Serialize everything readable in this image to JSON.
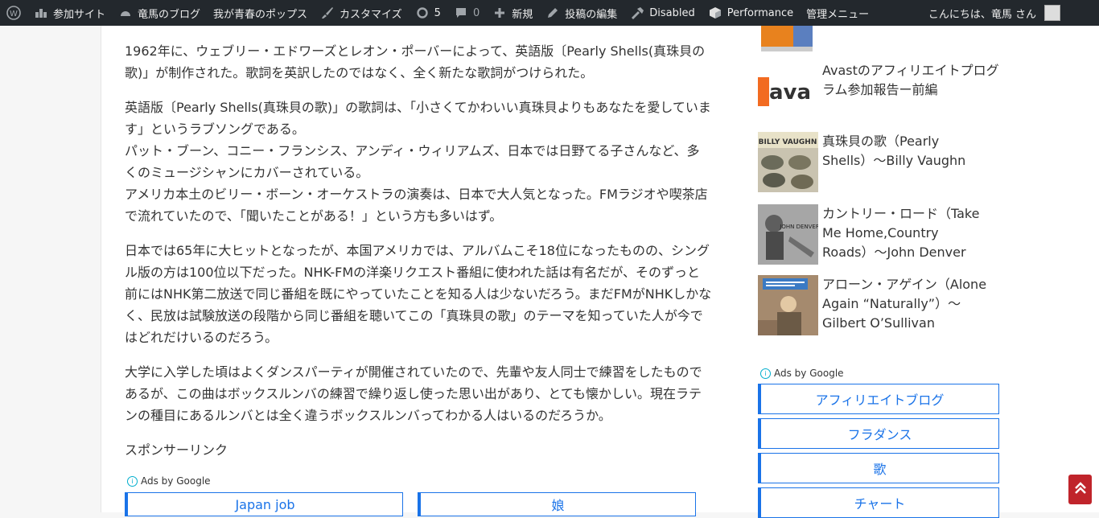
{
  "adminbar": {
    "items": [
      {
        "icon": "wordpress-icon",
        "label": ""
      },
      {
        "icon": "sites-icon",
        "label": "参加サイト"
      },
      {
        "icon": "dashboard-icon",
        "label": "竜馬のブログ"
      },
      {
        "icon": "",
        "label": "我が青春のポップス"
      },
      {
        "icon": "brush-icon",
        "label": "カスタマイズ"
      },
      {
        "icon": "updates-icon",
        "label": "5"
      },
      {
        "icon": "comment-icon",
        "label": "0"
      },
      {
        "icon": "plus-icon",
        "label": "新規"
      },
      {
        "icon": "pencil-icon",
        "label": "投稿の編集"
      },
      {
        "icon": "tool-icon",
        "label": "Disabled"
      },
      {
        "icon": "cube-icon",
        "label": "Performance"
      },
      {
        "icon": "",
        "label": "管理メニュー"
      }
    ],
    "greeting": "こんにちは、竜馬 さん"
  },
  "article": {
    "paragraphs": [
      "1962年に、ウェブリー・エドワーズとレオン・ポーバーによって、英語版〔Pearly Shells(真珠貝の歌)」が制作された。歌詞を英訳したのではなく、全く新たな歌詞がつけられた。",
      "英語版〔Pearly Shells(真珠貝の歌)」の歌詞は、「小さくてかわいい真珠貝よりもあなたを愛しています」というラブソングである。\nパット・ブーン、コニー・フランシス、アンディ・ウィリアムズ、日本では日野てる子さんなど、多くのミュージシャンにカバーされている。\nアメリカ本土のビリー・ボーン・オーケストラの演奏は、日本で大人気となった。FMラジオや喫茶店で流れていたので、「聞いたことがある！」という方も多いはず。",
      "日本では65年に大ヒットとなったが、本国アメリカでは、アルバムこそ18位になったものの、シングル版の方は100位以下だった。NHK-FMの洋楽リクエスト番組に使われた話は有名だが、そのずっと前にはNHK第二放送で同じ番組を既にやっていたことを知る人は少ないだろう。まだFMがNHKしかなく、民放は試験放送の段階から同じ番組を聴いてこの「真珠貝の歌」のテーマを知っていた人が今ではどれだけいるのだろう。",
      "大学に入学した頃はよくダンスパーティが開催されていたので、先輩や友人同士で練習をしたものであるが、この曲はボックスルンバの練習で繰り返し使った思い出があり、とても懐かしい。現在ラテンの種目にあるルンバとは全く違うボックスルンバってわかる人はいるのだろうか。"
    ],
    "sponsor": "スポンサーリンク",
    "ads_label": "Ads by Google",
    "ad_buttons": [
      "Japan job",
      "娘"
    ]
  },
  "sidebar": {
    "posts": [
      {
        "title": "Avastのアフィリエイトプログラム参加報告ー前編",
        "thumb_text": "ava"
      },
      {
        "title": "真珠貝の歌（Pearly Shells）〜Billy Vaughn",
        "thumb_text": "BILLY VAUGHN"
      },
      {
        "title": "カントリー・ロード（Take Me Home,Country Roads）〜John Denver",
        "thumb_text": "JOHN DENVER"
      },
      {
        "title": "アローン・アゲイン（Alone Again “Naturally”）〜Gilbert O’Sullivan",
        "thumb_text": ""
      }
    ],
    "ads_label": "Ads by Google",
    "ad_buttons": [
      "アフィリエイトブログ",
      "フラダンス",
      "歌",
      "チャート"
    ]
  },
  "colors": {
    "adminbar": "#23282d",
    "link": "#1a73e8",
    "totop": "#c0242b"
  }
}
